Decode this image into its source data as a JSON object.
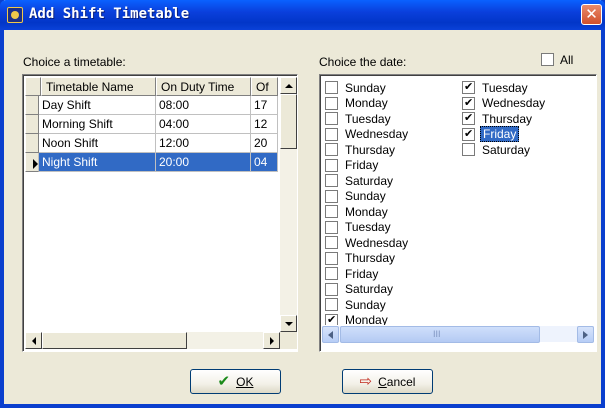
{
  "window": {
    "title": "Add Shift Timetable",
    "close_glyph": "✕"
  },
  "timetable": {
    "label": "Choice a timetable:",
    "columns": [
      "Timetable Name",
      "On Duty Time",
      "Of"
    ],
    "rows": [
      {
        "name": "Day Shift",
        "on_duty": "08:00",
        "off": "17"
      },
      {
        "name": "Morning Shift",
        "on_duty": "04:00",
        "off": "12"
      },
      {
        "name": "Noon Shift",
        "on_duty": "12:00",
        "off": "20"
      },
      {
        "name": "Night Shift",
        "on_duty": "20:00",
        "off": "04"
      }
    ],
    "selected_row": 3
  },
  "dates": {
    "label": "Choice the date:",
    "all_label": "All",
    "all_checked": false,
    "col1": [
      {
        "day": "Sunday",
        "checked": false
      },
      {
        "day": "Monday",
        "checked": false
      },
      {
        "day": "Tuesday",
        "checked": false
      },
      {
        "day": "Wednesday",
        "checked": false
      },
      {
        "day": "Thursday",
        "checked": false
      },
      {
        "day": "Friday",
        "checked": false
      },
      {
        "day": "Saturday",
        "checked": false
      },
      {
        "day": "Sunday",
        "checked": false
      },
      {
        "day": "Monday",
        "checked": false
      },
      {
        "day": "Tuesday",
        "checked": false
      },
      {
        "day": "Wednesday",
        "checked": false
      },
      {
        "day": "Thursday",
        "checked": false
      },
      {
        "day": "Friday",
        "checked": false
      },
      {
        "day": "Saturday",
        "checked": false
      },
      {
        "day": "Sunday",
        "checked": false
      },
      {
        "day": "Monday",
        "checked": true
      }
    ],
    "col2": [
      {
        "day": "Tuesday",
        "checked": true
      },
      {
        "day": "Wednesday",
        "checked": true
      },
      {
        "day": "Thursday",
        "checked": true
      },
      {
        "day": "Friday",
        "checked": true,
        "selected": true
      },
      {
        "day": "Saturday",
        "checked": false
      }
    ],
    "scroll_mid": "III"
  },
  "buttons": {
    "ok_label": "OK",
    "cancel_label": "Cancel"
  },
  "icons": {
    "ok": "checkmark-icon",
    "cancel": "exit-door-icon"
  },
  "colors": {
    "title_bar": "#0a3fdc",
    "selection": "#316ac5",
    "dialog_bg": "#ece9d8"
  }
}
